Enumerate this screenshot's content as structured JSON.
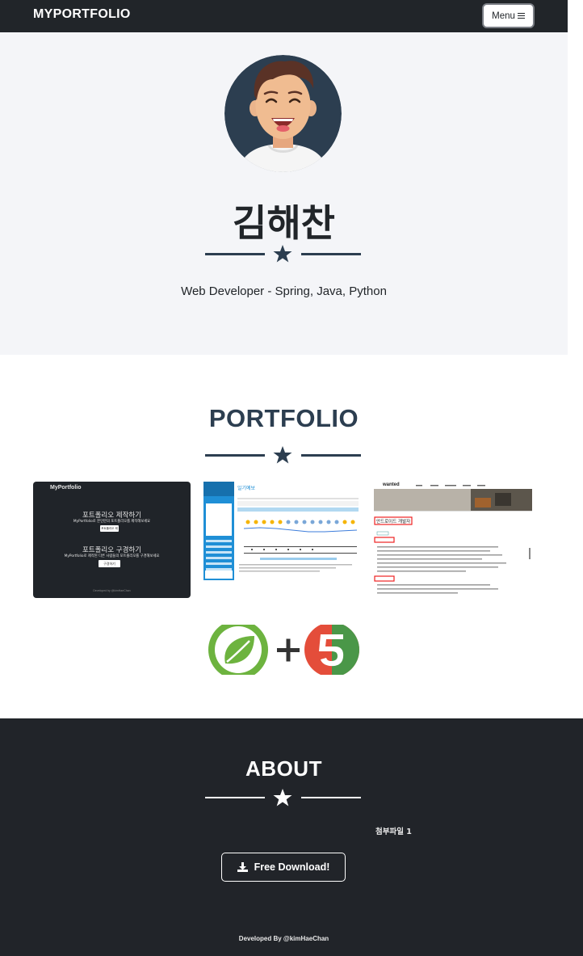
{
  "navbar": {
    "brand": "MYPORTFOLIO",
    "menu_label": "Menu"
  },
  "masthead": {
    "name": "김해찬",
    "subtitle": "Web Developer - Spring, Java, Python"
  },
  "portfolio": {
    "title": "PORTFOLIO",
    "items": [
      {
        "app_title": "MyPortfolio",
        "heading1": "포트폴리오 제작하기",
        "desc1": "MyPortfolio로 본인만의 포트폴리오를 제작해보세요",
        "btn1": "포트폴리오 제작",
        "heading2": "포트폴리오 구경하기",
        "desc2": "MyPortfolio로 제작된 다른 사람들의 포트폴리오를 구경해보세요",
        "btn2": "구경하기",
        "footer": "Developed by @kimHaeChan"
      },
      {
        "header": "일기예보"
      },
      {
        "brand": "wanted",
        "heading": "안드로이드 개발자"
      }
    ]
  },
  "about": {
    "title": "ABOUT",
    "attachment": "첨부파일 1",
    "download_label": "Free Download!",
    "credit": "Developed By @kimHaeChan"
  },
  "colors": {
    "navbar_bg": "#212529",
    "masthead_bg": "#f4f5f8",
    "primary": "#2c3e50",
    "about_bg": "#212429",
    "spring_green": "#6db33f",
    "js5_red": "#e44d3a"
  }
}
